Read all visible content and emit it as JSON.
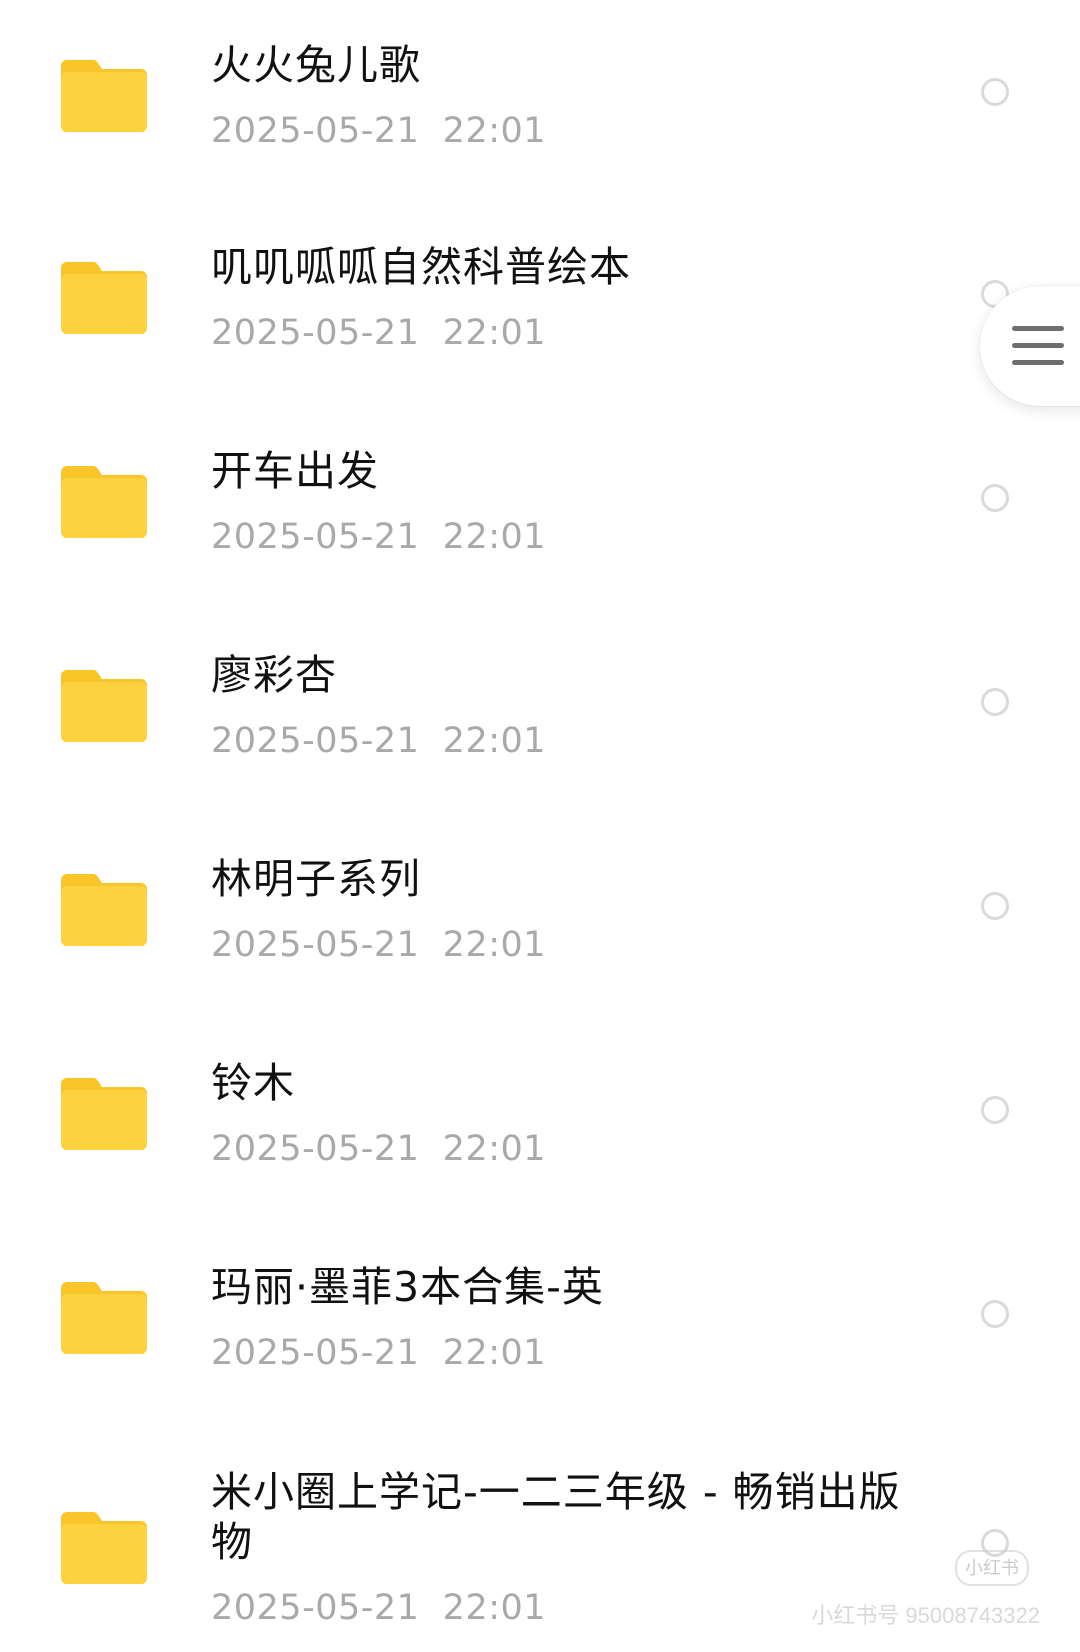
{
  "files": [
    {
      "name": "火火兔儿歌",
      "date": "2025-05-21",
      "time": "22:01"
    },
    {
      "name": "叽叽呱呱自然科普绘本",
      "date": "2025-05-21",
      "time": "22:01"
    },
    {
      "name": "开车出发",
      "date": "2025-05-21",
      "time": "22:01"
    },
    {
      "name": "廖彩杏",
      "date": "2025-05-21",
      "time": "22:01"
    },
    {
      "name": "林明子系列",
      "date": "2025-05-21",
      "time": "22:01"
    },
    {
      "name": "铃木",
      "date": "2025-05-21",
      "time": "22:01"
    },
    {
      "name": "玛丽·墨菲3本合集-英",
      "date": "2025-05-21",
      "time": "22:01"
    },
    {
      "name": "米小圈上学记-一二三年级 - 畅销出版物",
      "date": "2025-05-21",
      "time": "22:01"
    }
  ],
  "icons": {
    "folder": "folder-icon",
    "menu": "menu-icon"
  },
  "colors": {
    "folder_body": "#FDD23E",
    "folder_tab": "#F9C62A",
    "date_text": "#A9A9A9",
    "name_text": "#111111"
  },
  "watermark": {
    "badge": "小红书",
    "text": "小红书号 95008743322"
  }
}
